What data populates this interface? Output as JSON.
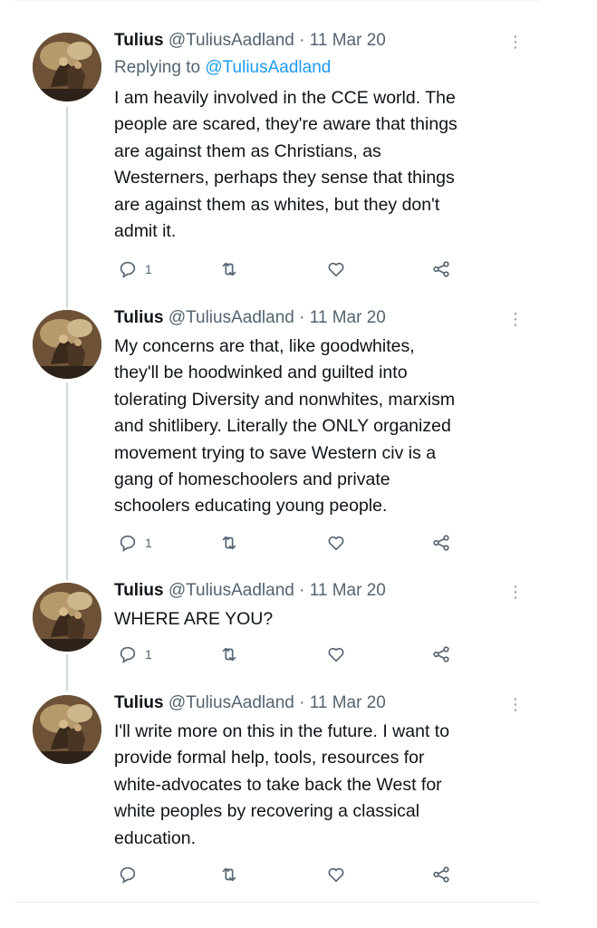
{
  "tweets": [
    {
      "name": "Tulius",
      "handle": "@TuliusAadland",
      "separator": "·",
      "date": "11 Mar 20",
      "replying_prefix": "Replying to ",
      "replying_to": "@TuliusAadland",
      "text": "I am heavily involved in the CCE world. The\npeople are scared, they're aware that things\nare against them as Christians, as\nWesterners, perhaps they sense that things\nare against them as whites, but they don't\nadmit it.",
      "reply_count": "1"
    },
    {
      "name": "Tulius",
      "handle": "@TuliusAadland",
      "separator": "·",
      "date": "11 Mar 20",
      "text": "My concerns are that, like goodwhites,\nthey'll be hoodwinked and guilted into\ntolerating Diversity and nonwhites, marxism\nand shitlibery. Literally the ONLY organized\nmovement trying to save Western civ is a\ngang of homeschoolers and private\nschoolers educating young people.",
      "reply_count": "1"
    },
    {
      "name": "Tulius",
      "handle": "@TuliusAadland",
      "separator": "·",
      "date": "11 Mar 20",
      "text": "WHERE ARE YOU?",
      "reply_count": "1"
    },
    {
      "name": "Tulius",
      "handle": "@TuliusAadland",
      "separator": "·",
      "date": "11 Mar 20",
      "text": "I'll write more on this in the future. I want to\nprovide formal help, tools, resources for\nwhite-advocates to take back the West for\nwhite peoples by recovering a classical\neducation.",
      "reply_count": ""
    }
  ],
  "icons": {
    "more": "more-vertical-icon",
    "reply": "reply-icon",
    "retweet": "retweet-icon",
    "like": "heart-icon",
    "share": "share-icon"
  },
  "colors": {
    "text": "#0f1419",
    "secondary": "#536471",
    "link": "#1d9bf0",
    "thread_line": "#cfd9de"
  }
}
